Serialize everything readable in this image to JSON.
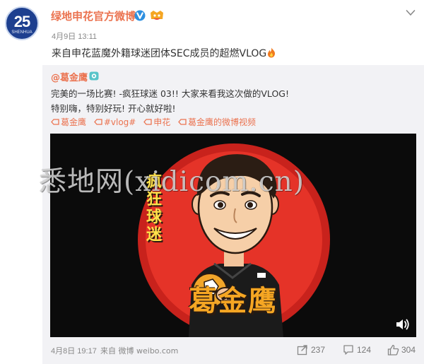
{
  "account": {
    "name": "绿地申花官方微博",
    "avatar_number": "25",
    "avatar_text": "SHENHUA",
    "post_time": "4月9日 13:11",
    "accent_color": "#eb7350"
  },
  "post": {
    "text": "来自申花蓝魔外籍球迷团体SEC成员的超燃VLOG"
  },
  "repost": {
    "author": "@葛金鹰",
    "line1": "完美的一场比赛! -疯狂球迷 03!! 大家来看我这次做的VLOG!",
    "line2": "特别嗨，特别好玩! 开心就好啦!",
    "tags": [
      {
        "label": "葛金鹰",
        "icon": "link-icon"
      },
      {
        "label": "#vlog#",
        "icon": "link-icon"
      },
      {
        "label": "申花",
        "icon": "link-icon"
      },
      {
        "label": "葛金鹰的微博视频",
        "icon": "link-icon"
      }
    ],
    "video": {
      "badge_text": "疯狂球迷",
      "name_text": "葛金鹰"
    },
    "footer": {
      "time": "4月8日 19:17",
      "source": "来自 微博 weibo.com",
      "reposts": "237",
      "comments": "124",
      "likes": "304"
    }
  },
  "watermark": "悉地网(xidicom.cn)"
}
